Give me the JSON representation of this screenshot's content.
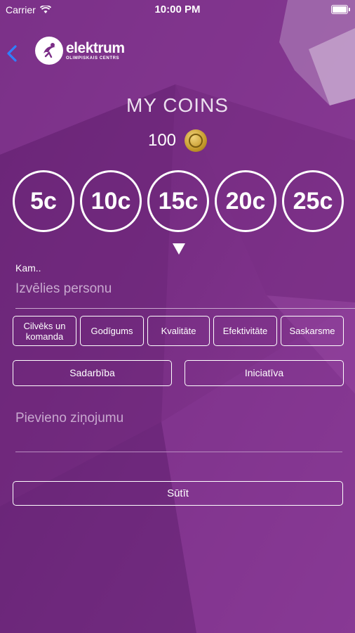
{
  "status_bar": {
    "carrier": "Carrier",
    "time": "10:00 PM"
  },
  "header": {
    "logo_name": "elektrum",
    "logo_sub": "OLIMPISKAIS CENTRS"
  },
  "page": {
    "title": "MY COINS",
    "balance": "100"
  },
  "coin_options": [
    "5c",
    "10c",
    "15c",
    "20c",
    "25c"
  ],
  "form": {
    "recipient_label": "Kam..",
    "recipient_placeholder": "Izvēlies personu",
    "values_row1": [
      {
        "label": "Cilvēks un komanda"
      },
      {
        "label": "Godīgums"
      },
      {
        "label": "Kvalitāte"
      },
      {
        "label": "Efektivitāte"
      },
      {
        "label": "Saskarsme"
      }
    ],
    "values_row2": [
      {
        "label": "Sadarbība"
      },
      {
        "label": "Iniciatīva"
      }
    ],
    "message_placeholder": "Pievieno ziņojumu",
    "send_label": "Sūtīt"
  },
  "colors": {
    "background": "#7a2d86",
    "accent": "#2f80ff",
    "coin_gold": "#c59a2c"
  }
}
